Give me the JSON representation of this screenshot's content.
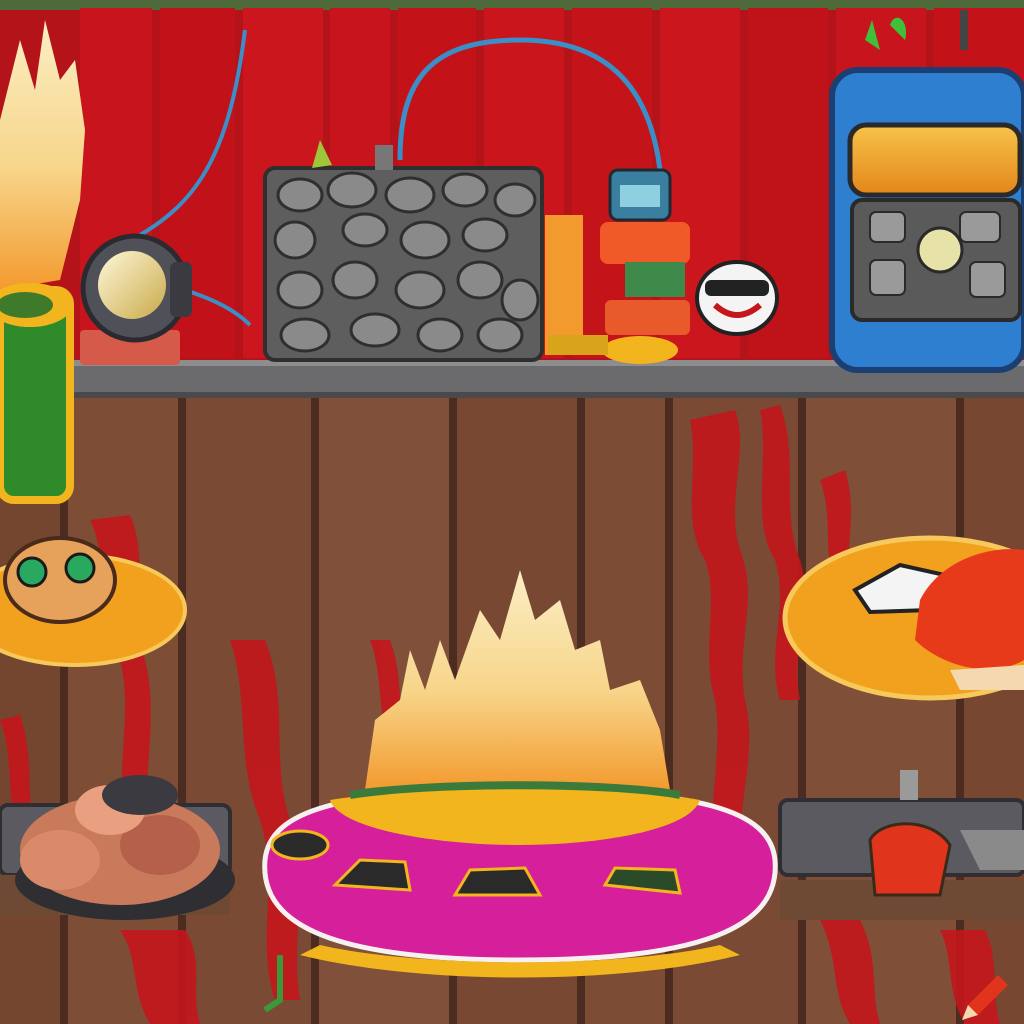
{
  "scene": {
    "palette": {
      "upper_wall_red": "#c8141c",
      "upper_wall_dark": "#8e0d12",
      "shelf_gray": "#6b6b6e",
      "lower_wood": "#7a4a34",
      "lower_wood_dark": "#4c2b20",
      "paint_red": "#c4161c",
      "cauldron_magenta": "#d61f9a",
      "cauldron_yellow": "#f2b51e",
      "flame_cream": "#f7e3a6",
      "flame_orange": "#f39a2e",
      "robot_blue": "#2f7fd1",
      "stone_gray": "#5e5e5e"
    },
    "objects": [
      "stone-block-generator",
      "spotlight-lamp",
      "small-robot-figure",
      "blue-robot-head-machine",
      "flaming-green-barrel",
      "magenta-cauldron-with-flames",
      "meat-bowl",
      "orange-plate-left",
      "orange-plate-right",
      "grill-tray-right",
      "pencil-icon"
    ]
  }
}
